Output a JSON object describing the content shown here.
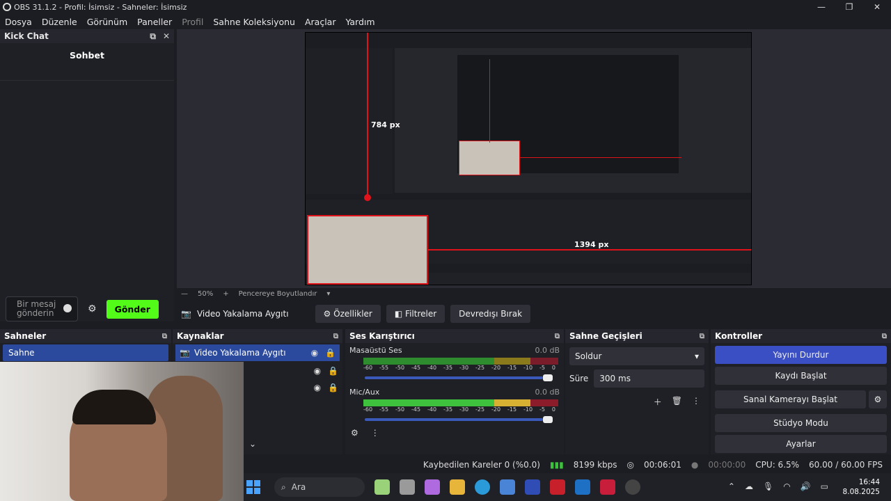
{
  "window": {
    "title": "OBS 31.1.2 - Profil: İsimsiz - Sahneler: İsimsiz"
  },
  "menu": [
    "Dosya",
    "Düzenle",
    "Görünüm",
    "Paneller",
    "Profil",
    "Sahne Koleksiyonu",
    "Araçlar",
    "Yardım"
  ],
  "chat": {
    "title": "Kick Chat",
    "heading": "Sohbet",
    "placeholder": "Bir mesaj gönderin",
    "send": "Gönder"
  },
  "preview": {
    "measure_v": "784 px",
    "measure_h": "1394 px",
    "zoom": "50%",
    "fit": "Pencereye Boyutlandır"
  },
  "source_toolbar": {
    "source": "Video Yakalama Aygıtı",
    "properties": "Özellikler",
    "filters": "Filtreler",
    "deactivate": "Devredışı Bırak"
  },
  "scenes": {
    "title": "Sahneler",
    "items": [
      "Sahne"
    ]
  },
  "sources": {
    "title": "Kaynaklar",
    "items": [
      "Video Yakalama Aygıtı"
    ]
  },
  "mixer": {
    "title": "Ses Karıştırıcı",
    "channels": [
      {
        "name": "Masaüstü Ses",
        "db": "0.0 dB"
      },
      {
        "name": "Mic/Aux",
        "db": "0.0 dB"
      }
    ],
    "ticks": [
      "-60",
      "-55",
      "-50",
      "-45",
      "-40",
      "-35",
      "-30",
      "-25",
      "-20",
      "-15",
      "-10",
      "-5",
      "0"
    ]
  },
  "transitions": {
    "title": "Sahne Geçişleri",
    "type": "Soldur",
    "duration_label": "Süre",
    "duration": "300 ms"
  },
  "controls": {
    "title": "Kontroller",
    "stop_stream": "Yayını Durdur",
    "start_record": "Kaydı Başlat",
    "virtual_cam": "Sanal Kamerayı Başlat",
    "studio": "Stüdyo Modu",
    "settings": "Ayarlar"
  },
  "status": {
    "dropped": "Kaybedilen Kareler 0 (%0.0)",
    "kbps": "8199 kbps",
    "stream_time": "00:06:01",
    "rec_time": "00:00:00",
    "cpu": "CPU: 6.5%",
    "fps": "60.00 / 60.00 FPS"
  },
  "taskbar": {
    "search": "Ara",
    "time": "16:44",
    "date": "8.08.2025"
  },
  "colors": {
    "accent": "#3b4fc4",
    "kick_green": "#53fc18",
    "measure_red": "#e0131a"
  }
}
